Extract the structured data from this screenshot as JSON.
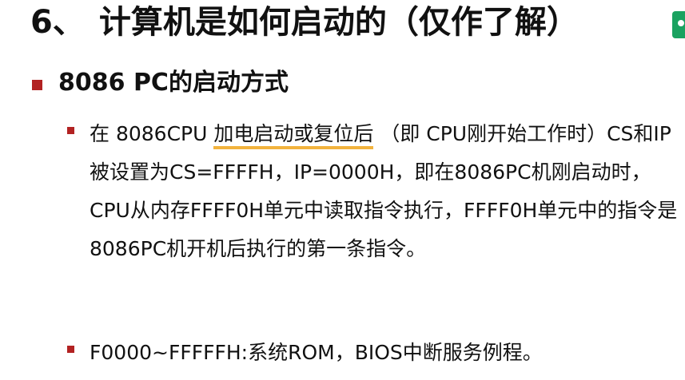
{
  "slide": {
    "title_number": "6、",
    "title_text": "计算机是如何启动的（仅作了解）",
    "section_heading": "8086 PC的启动方式",
    "point1": {
      "before_highlight": "在 8086CPU ",
      "highlight": "加电启动或复位后",
      "after_highlight": " （即 CPU刚开始工作时）CS和IP被设置为CS=FFFFH，IP=0000H，即在8086PC机刚启动时，CPU从内存FFFF0H单元中读取指令执行，FFFF0H单元中的指令是8086PC机开机后执行的第一条指令。"
    },
    "point2": "F0000~FFFFFH:系统ROM，BIOS中断服务例程。"
  },
  "colors": {
    "bullet_marker": "#b22222",
    "highlight_underline": "#f2b33d",
    "corner_badge": "#1aa260"
  },
  "icons": {
    "corner_badge": "app-badge-icon"
  }
}
